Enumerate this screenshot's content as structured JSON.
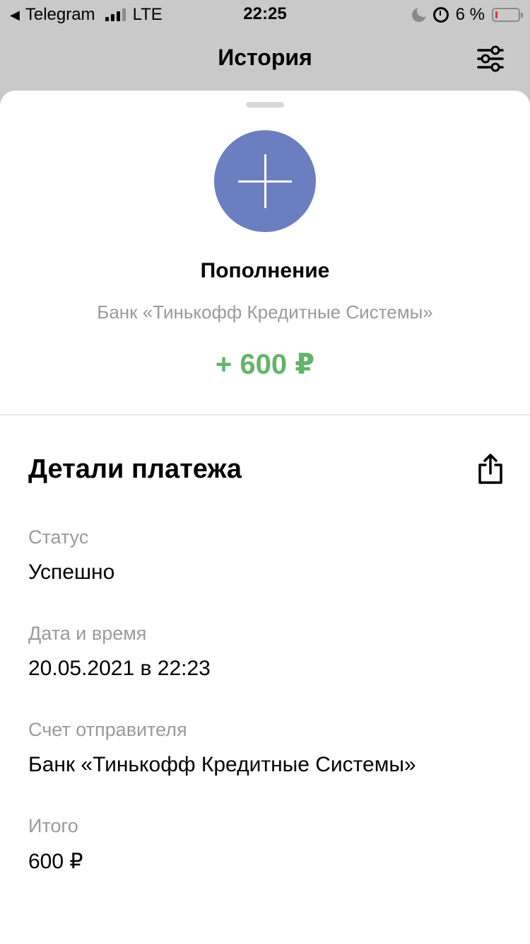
{
  "status_bar": {
    "back_app": "Telegram",
    "network": "LTE",
    "time": "22:25",
    "battery": "6 %"
  },
  "nav": {
    "title": "История",
    "filter_icon": "sliders-icon"
  },
  "operation": {
    "icon": "plus-icon",
    "icon_color": "#6b7fc0",
    "title": "Пополнение",
    "subtitle": "Банк «Тинькофф Кредитные Системы»",
    "amount": "+ 600 ₽",
    "amount_color": "#62b46a"
  },
  "details": {
    "title": "Детали платежа",
    "share_icon": "share-icon",
    "fields": [
      {
        "label": "Статус",
        "value": "Успешно"
      },
      {
        "label": "Дата и время",
        "value": "20.05.2021 в 22:23"
      },
      {
        "label": "Счет отправителя",
        "value": "Банк «Тинькофф Кредитные Системы»"
      },
      {
        "label": "Итого",
        "value": "600 ₽"
      }
    ]
  }
}
